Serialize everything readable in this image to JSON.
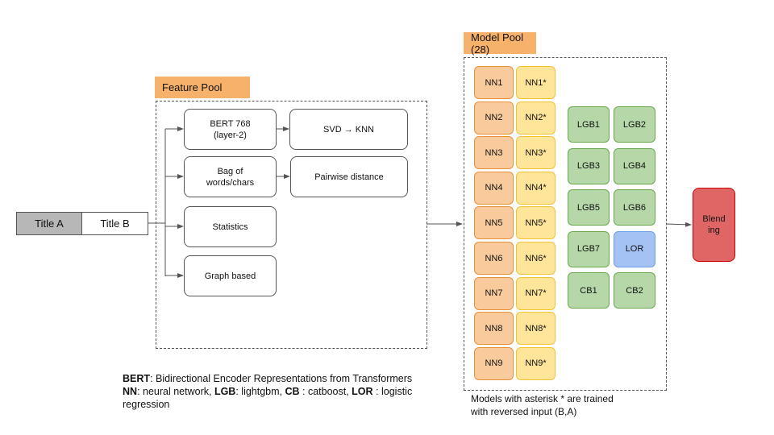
{
  "inputs": {
    "title_a": "Title A",
    "title_b": "Title B"
  },
  "feature_pool": {
    "label": "Feature Pool",
    "features": [
      {
        "line1": "BERT 768",
        "line2": "(layer-2)"
      },
      {
        "line1": "Bag of",
        "line2": "words/chars"
      },
      {
        "line1": "Statistics",
        "line2": ""
      },
      {
        "line1": "Graph based",
        "line2": ""
      }
    ],
    "derived": [
      {
        "label": "SVD → KNN"
      },
      {
        "label": "Pairwise distance"
      }
    ]
  },
  "model_pool": {
    "label": "Model Pool (28)",
    "nn": [
      "NN1",
      "NN2",
      "NN3",
      "NN4",
      "NN5",
      "NN6",
      "NN7",
      "NN8",
      "NN9"
    ],
    "nn_reversed": [
      "NN1*",
      "NN2*",
      "NN3*",
      "NN4*",
      "NN5*",
      "NN6*",
      "NN7*",
      "NN8*",
      "NN9*"
    ],
    "grid": [
      [
        "LGB1",
        "LGB2"
      ],
      [
        "LGB3",
        "LGB4"
      ],
      [
        "LGB5",
        "LGB6"
      ],
      [
        "LGB7",
        "LOR"
      ],
      [
        "CB1",
        "CB2"
      ]
    ],
    "note_line1": "Models with asterisk * are trained",
    "note_line2": "with reversed input (B,A)"
  },
  "blending": {
    "line1": "Blend",
    "line2": "ing"
  },
  "legend": {
    "line1": [
      {
        "b": "BERT"
      },
      {
        "t": ": Bidirectional Encoder Representations from Transformers"
      }
    ],
    "line2": [
      {
        "b": "NN"
      },
      {
        "t": ": neural network, "
      },
      {
        "b": "LGB"
      },
      {
        "t": ": lightgbm, "
      },
      {
        "b": "CB"
      },
      {
        "t": " : catboost, "
      },
      {
        "b": "LOR"
      },
      {
        "t": " : logistic"
      }
    ],
    "line3": [
      {
        "t": "regression"
      }
    ]
  },
  "colors": {
    "nn": "#f9cb9c",
    "nn_reversed": "#ffe599",
    "gbm": "#b6d7a8",
    "lor": "#a4c2f4",
    "blending": "#e06666",
    "tag": "#f6b26b",
    "title_a": "#b7b7b7"
  }
}
